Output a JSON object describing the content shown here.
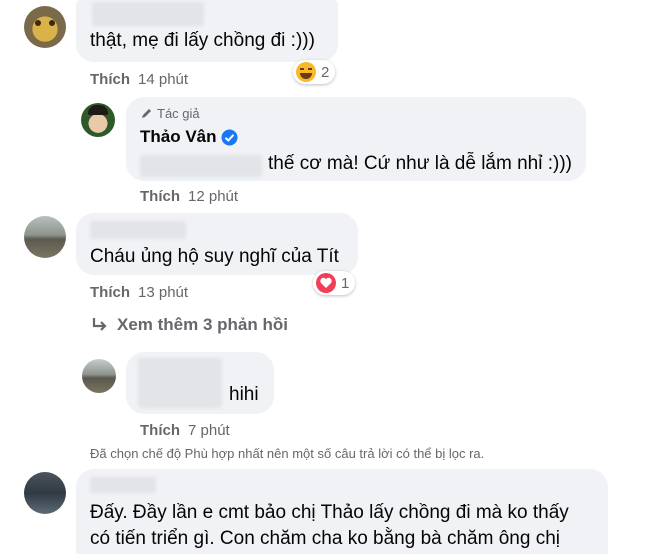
{
  "comments": [
    {
      "text": "thật, mẹ đi lấy chồng đi :)))",
      "like_label": "Thích",
      "time": "14 phút",
      "reaction": {
        "icon": "haha-emoji-icon",
        "count": "2"
      }
    },
    {
      "author_badge": "Tác giả",
      "author_name": "Thảo Vân",
      "text": "thế cơ mà! Cứ như là dễ lắm nhỉ :)))",
      "like_label": "Thích",
      "time": "12 phút"
    },
    {
      "text": "Cháu ủng hộ suy nghĩ của Tít",
      "like_label": "Thích",
      "time": "13 phút",
      "reaction": {
        "icon": "love-heart-icon",
        "count": "1"
      }
    },
    {
      "text": "hihi",
      "like_label": "Thích",
      "time": "7 phút"
    },
    {
      "text_line1": "Đấy. Đầy lần e cmt bảo chị Thảo lấy chồng đi mà ko thấy",
      "text_line2": "có tiến triển gì. Con chăm cha ko bằng bà chăm ông chị"
    }
  ],
  "view_more": "Xem thêm 3 phản hồi",
  "filter_notice": "Đã chọn chế độ Phù hợp nhất nên một số câu trả lời có thể bị lọc ra.",
  "colors": {
    "bubble": "#f0f2f5",
    "meta": "#65676b",
    "verified": "#1877f2",
    "love": "#f33e58",
    "haha": "#f7b928"
  }
}
